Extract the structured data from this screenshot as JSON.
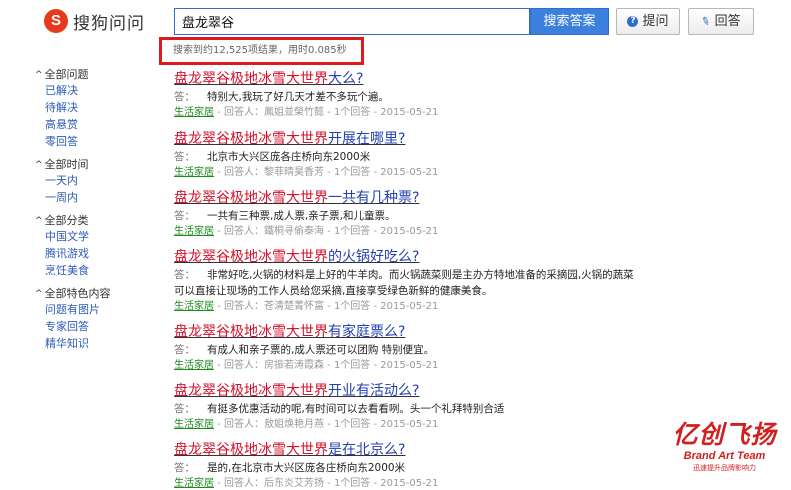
{
  "header": {
    "logo_text": "搜狗问问",
    "search_value": "盘龙翠谷",
    "search_button": "搜索答案",
    "ask_button": "提问",
    "answer_button": "回答"
  },
  "result_count": "搜索到约12,525项结果，用时0.085秒",
  "sidebar": [
    {
      "title": "全部问题",
      "items": [
        "已解决",
        "待解决",
        "高悬赏",
        "零回答"
      ]
    },
    {
      "title": "全部时间",
      "items": [
        "一天内",
        "一周内"
      ]
    },
    {
      "title": "全部分类",
      "items": [
        "中国文学",
        "腾讯游戏",
        "烹饪美食"
      ]
    },
    {
      "title": "全部特色内容",
      "items": [
        "问题有图片",
        "专家回答",
        "精华知识"
      ]
    }
  ],
  "results": [
    {
      "title_hl": "盘龙翠谷极地冰雪大世界",
      "title_rest": "大么?",
      "answer_label": "答：",
      "answer": "特别大,我玩了好几天才差不多玩个遍。",
      "category": "生活家居",
      "responder": "回答人：鳳姐並榮竹懿",
      "answers": "1个回答",
      "date": "2015-05-21"
    },
    {
      "title_hl": "盘龙翠谷极地冰雪大世界",
      "title_rest": "开展在哪里?",
      "answer_label": "答：",
      "answer": "北京市大兴区庞各庄桥向东2000米",
      "category": "生活家居",
      "responder": "回答人：黎菲晴昊香芳",
      "answers": "1个回答",
      "date": "2015-05-21"
    },
    {
      "title_hl": "盘龙翠谷极地冰雪大世界",
      "title_rest": "一共有几种票?",
      "answer_label": "答：",
      "answer": "一共有三种票,成人票,亲子票,和儿童票。",
      "category": "生活家居",
      "responder": "回答人：鐵桐寻偷泰海",
      "answers": "1个回答",
      "date": "2015-05-21"
    },
    {
      "title_hl": "盘龙翠谷极地冰雪大世界",
      "title_rest": "的火锅好吃么?",
      "answer_label": "答：",
      "answer": "非常好吃,火锅的材料是上好的牛羊肉。而火锅蔬菜则是主办方特地准备的采摘园,火锅的蔬菜可以直接让现场的工作人员给您采摘,直接享受绿色新鲜的健康美食。",
      "category": "生活家居",
      "responder": "回答人：苍清楚菁怀富",
      "answers": "1个回答",
      "date": "2015-05-21"
    },
    {
      "title_hl": "盘龙翠谷极地冰雪大世界",
      "title_rest": "有家庭票么?",
      "answer_label": "答：",
      "answer": "有成人和亲子票的,成人票还可以团购 特别便宜。",
      "category": "生活家居",
      "responder": "回答人：房振若涛霞森",
      "answers": "1个回答",
      "date": "2015-05-21"
    },
    {
      "title_hl": "盘龙翠谷极地冰雪大世界",
      "title_rest": "开业有活动么?",
      "answer_label": "答：",
      "answer": "有挺多优惠活动的呢,有时间可以去看看咧。头一个礼拜特别合适",
      "category": "生活家居",
      "responder": "回答人：敖姐焕艳月燕",
      "answers": "1个回答",
      "date": "2015-05-21"
    },
    {
      "title_hl": "盘龙翠谷极地冰雪大世界",
      "title_rest": "是在北京么?",
      "answer_label": "答：",
      "answer": "是的,在北京市大兴区庞各庄桥向东2000米",
      "category": "生活家居",
      "responder": "回答人：后东炎艾芳扬",
      "answers": "1个回答",
      "date": "2015-05-21"
    }
  ],
  "watermark": {
    "cn": "亿创飞扬",
    "en": "Brand Art Team",
    "sub": "迅速提升品牌影响力"
  },
  "meta_separator": " - "
}
